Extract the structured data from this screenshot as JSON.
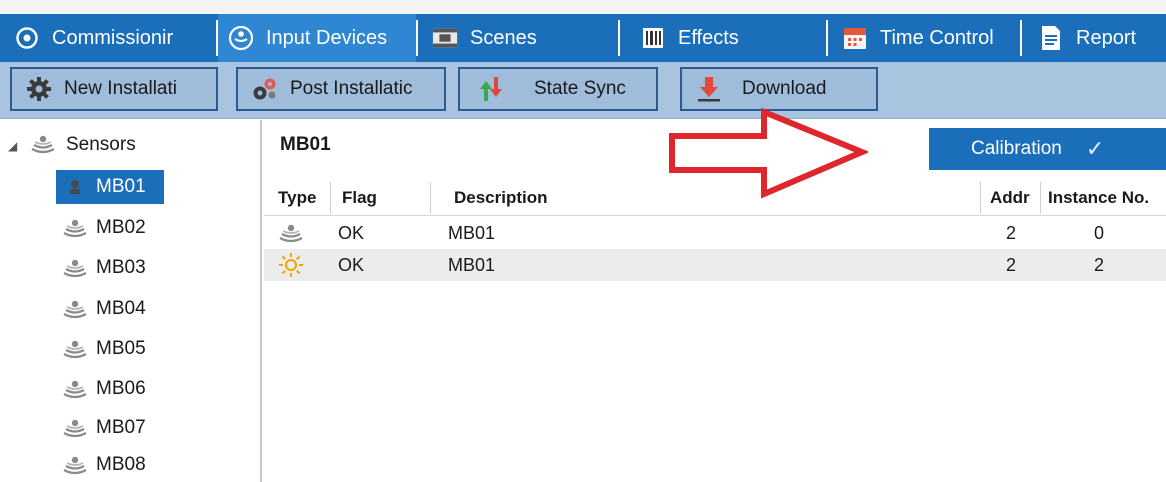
{
  "tabs": [
    {
      "label": "Commissionir",
      "icon": "target-icon",
      "active": false
    },
    {
      "label": "Input Devices",
      "icon": "sensor-circle-icon",
      "active": true
    },
    {
      "label": "Scenes",
      "icon": "film-icon",
      "active": false
    },
    {
      "label": "Effects",
      "icon": "barcode-icon",
      "active": false
    },
    {
      "label": "Time Control",
      "icon": "calendar-icon",
      "active": false
    },
    {
      "label": "Report",
      "icon": "document-icon",
      "active": false
    }
  ],
  "toolbar": [
    {
      "label": "New Installati",
      "icon": "gear-icon"
    },
    {
      "label": "Post Installatic",
      "icon": "gear-pair-icon"
    },
    {
      "label": "State Sync",
      "icon": "sync-arrows-icon"
    },
    {
      "label": "Download",
      "icon": "download-icon"
    }
  ],
  "tree": {
    "root": {
      "label": "Sensors",
      "expander": "◢",
      "icon": "sensor-icon"
    },
    "items": [
      {
        "label": "MB01",
        "selected": true
      },
      {
        "label": "MB02",
        "selected": false
      },
      {
        "label": "MB03",
        "selected": false
      },
      {
        "label": "MB04",
        "selected": false
      },
      {
        "label": "MB05",
        "selected": false
      },
      {
        "label": "MB06",
        "selected": false
      },
      {
        "label": "MB07",
        "selected": false
      },
      {
        "label": "MB08",
        "selected": false
      }
    ]
  },
  "panel": {
    "title": "MB01",
    "calibration_label": "Calibration",
    "calibration_check": "✓"
  },
  "grid": {
    "columns": [
      "Type",
      "Flag",
      "Description",
      "Addr",
      "Instance No."
    ],
    "rows": [
      {
        "type_icon": "sensor-icon",
        "flag": "OK",
        "description": "MB01",
        "addr": "2",
        "instance": "0"
      },
      {
        "type_icon": "sun-icon",
        "flag": "OK",
        "description": "MB01",
        "addr": "2",
        "instance": "2"
      }
    ]
  },
  "colors": {
    "tab_bar": "#1b6fba",
    "tab_active": "#2f86d2",
    "toolbar": "#a9c4de",
    "selection": "#1b6fba",
    "annotation_arrow": "#e0262d"
  }
}
